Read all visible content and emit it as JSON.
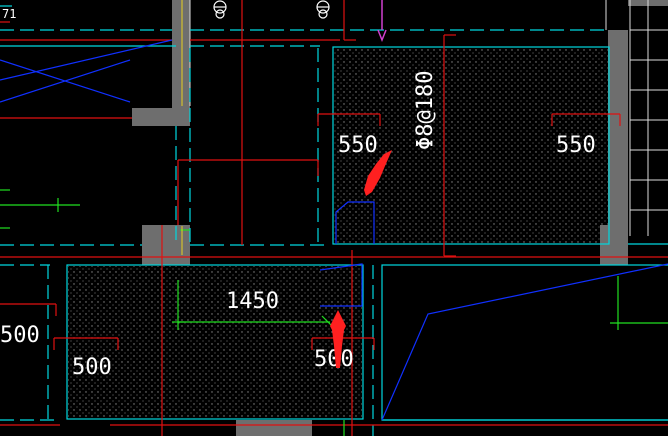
{
  "app": {
    "kind": "cad-drawing-viewport"
  },
  "colors": {
    "background": "#000000",
    "wall": "#6e6e6e",
    "cyan": "#00d8e0",
    "red": "#e01010",
    "blue": "#1030ff",
    "green": "#20e020",
    "white": "#ffffff",
    "magenta": "#d040d0",
    "arrow": "#ff2020",
    "hatch_dot": "#8a8a8a"
  },
  "annotations": {
    "top_left_fragment": "71",
    "rebar_spec": "Φ8@180",
    "dim_550_left": "550",
    "dim_550_right": "550",
    "dim_1450": "1450",
    "dim_500_far_left": "500",
    "dim_500_left": "500",
    "dim_500_right": "500"
  },
  "markers": [
    {
      "name": "red-arrow-upper",
      "points_to": "slab-opening-upper"
    },
    {
      "name": "red-arrow-lower",
      "points_to": "slab-opening-lower"
    }
  ]
}
